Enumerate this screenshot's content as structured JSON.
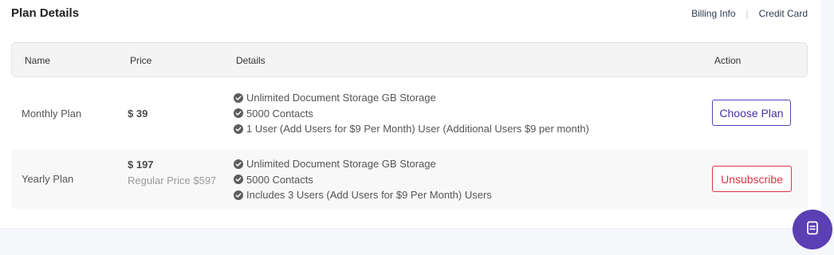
{
  "page": {
    "title": "Plan Details",
    "links": {
      "billing_info": "Billing Info",
      "separator": "|",
      "credit_card": "Credit Card"
    }
  },
  "table": {
    "headers": {
      "name": "Name",
      "price": "Price",
      "details": "Details",
      "action": "Action"
    },
    "rows": [
      {
        "name": "Monthly Plan",
        "price": "$ 39",
        "features": [
          "Unlimited Document Storage GB Storage",
          "5000 Contacts",
          "1 User (Add Users for $9 Per Month) User (Additional Users $9 per month)"
        ],
        "action": "Choose Plan"
      },
      {
        "name": "Yearly Plan",
        "price": "$ 197",
        "price_note": "Regular Price $597",
        "features": [
          "Unlimited Document Storage GB Storage",
          "5000 Contacts",
          "Includes 3 Users (Add Users for $9 Per Month) Users"
        ],
        "action": "Unsubscribe"
      }
    ]
  },
  "icons": {
    "feature": "check-circle-icon",
    "fab": "chat-icon"
  },
  "colors": {
    "accent": "#5b3fb5",
    "danger": "#dc3545",
    "check": "#5d5d5d"
  }
}
